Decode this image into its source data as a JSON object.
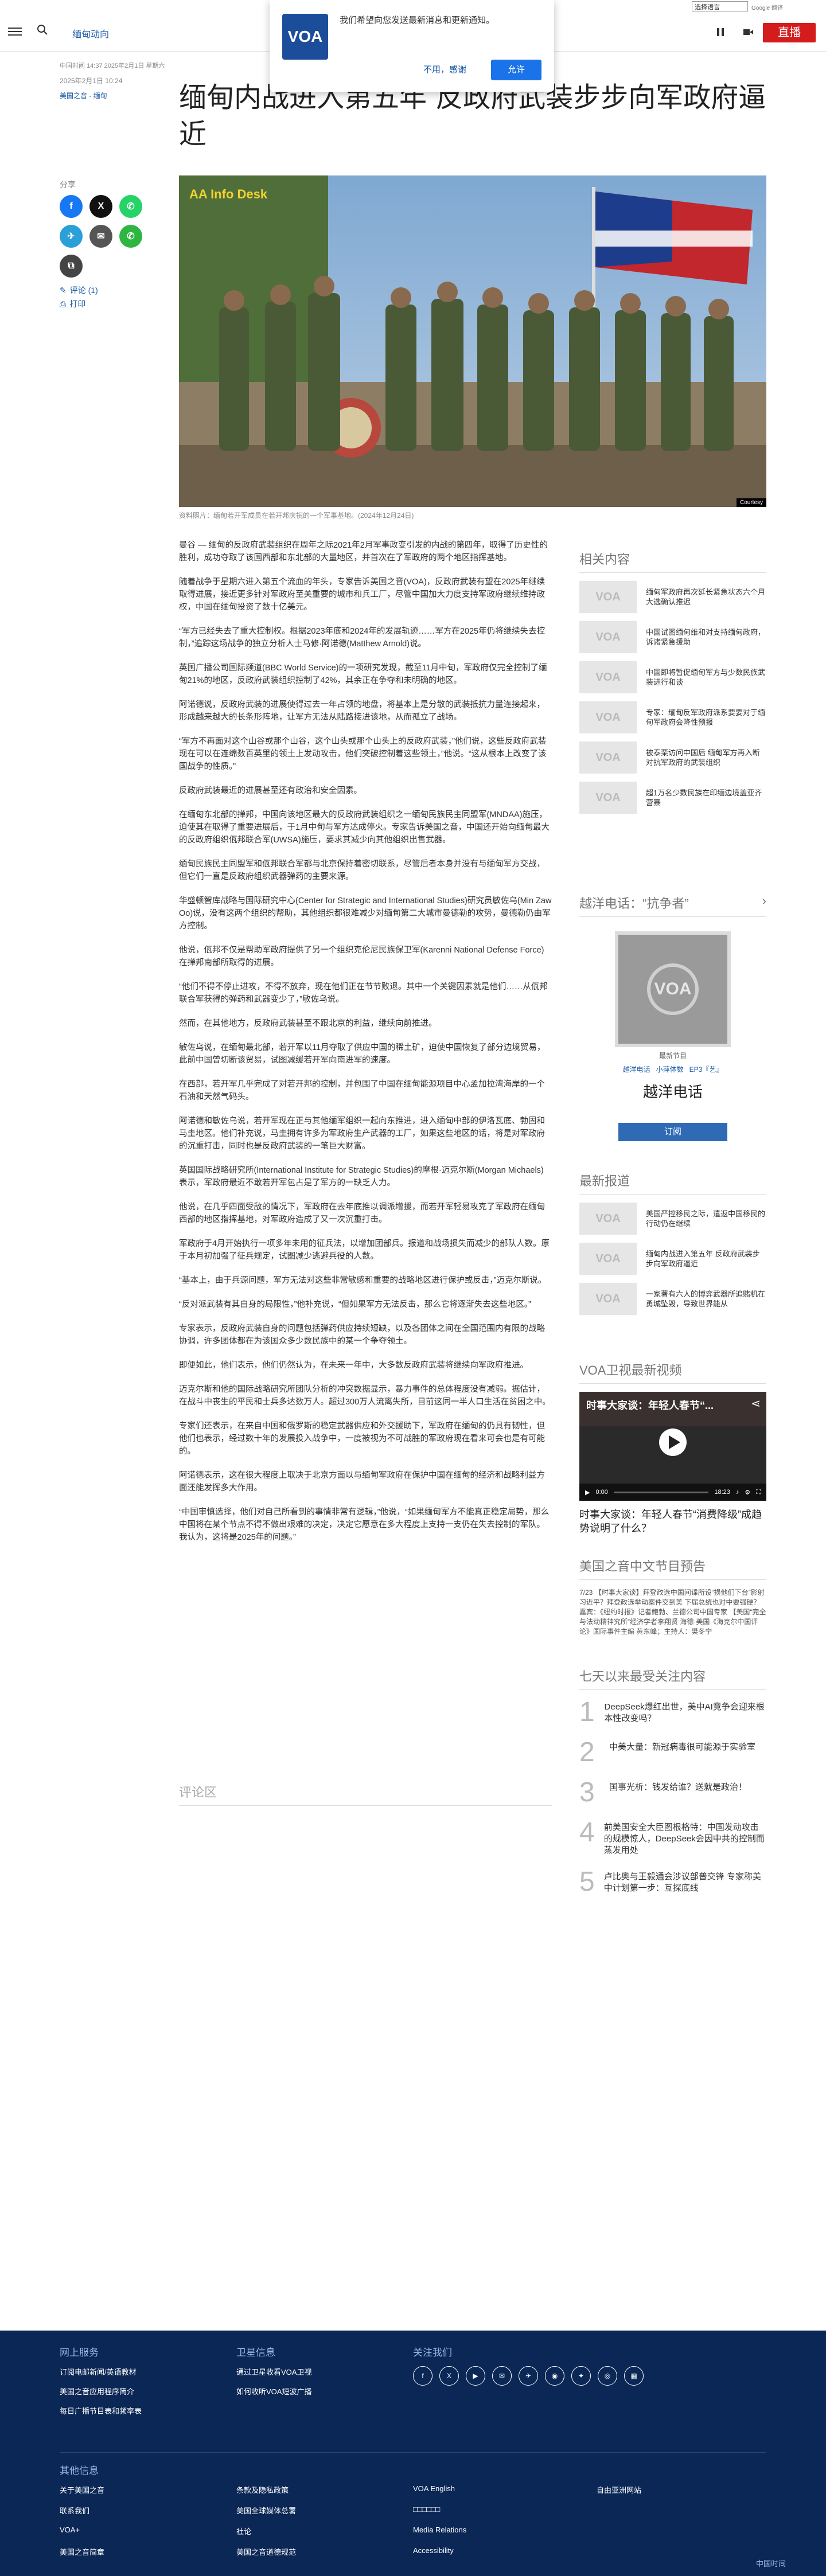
{
  "top": {
    "language_select": "选择语言",
    "translate_badge": "Google 翻译"
  },
  "header": {
    "section": "缅甸动向",
    "live": "直播"
  },
  "popup": {
    "logo": "VOA",
    "message": "我们希望向您发送最新消息和更新通知。",
    "deny": "不用，感谢",
    "allow": "允许"
  },
  "meta": {
    "date_line": "中国时间 14:37 2025年2月1日 星期六",
    "date2": "2025年2月1日 10:24",
    "author": "美国之音 - 缅甸"
  },
  "article": {
    "title": "缅甸内战进入第五年 反政府武装步步向军政府逼近",
    "image_label": "AA Info Desk",
    "image_credit": "Courtesy",
    "caption": "资料照片：缅甸若开军成员在若开邦庆祝的一个军事基地。(2024年12月24日)",
    "paragraphs": [
      "曼谷 — 缅甸的反政府武装组织在周年之际2021年2月军事政变引发的内战的第四年，取得了历史性的胜利，成功夺取了该国西部和东北部的大量地区，并首次在了军政府的两个地区指挥基地。",
      "随着战争于星期六进入第五个流血的年头，专家告诉美国之音(VOA)，反政府武装有望在2025年继续取得进展，接近更多针对军政府至关重要的城市和兵工厂，尽管中国加大力度支持军政府继续维持政权，中国在缅甸投资了数十亿美元。",
      "“军方已经失去了重大控制权。根据2023年底和2024年的发展轨迹……军方在2025年仍将继续失去控制，”追踪这场战争的独立分析人士马修·阿诺德(Matthew Arnold)说。",
      "英国广播公司国际频道(BBC World Service)的一项研究发现，截至11月中旬，军政府仅完全控制了缅甸21%的地区，反政府武装组织控制了42%，其余正在争夺和未明确的地区。",
      "阿诺德说，反政府武装的进展使得过去一年占领的地盘，将基本上是分散的武装抵抗力量连接起来，形成越来越大的长条形阵地，让军方无法从陆路接进该地，从而孤立了战场。",
      "“军方不再面对这个山谷或那个山谷，这个山头或那个山头上的反政府武装，”他们说，这些反政府武装现在可以在连绵数百英里的领土上发动攻击，他们突破控制着这些领土，”他说。“这从根本上改变了该国战争的性质。”",
      "反政府武装最近的进展甚至还有政治和安全因素。",
      "在缅甸东北部的掸邦，中国向该地区最大的反政府武装组织之一缅甸民族民主同盟军(MNDAA)施压，迫使其在取得了重要进展后，于1月中旬与军方达成停火。专家告诉美国之音，中国还开始向缅甸最大的反政府组织佤邦联合军(UWSA)施压，要求其减少向其他组织出售武器。",
      "缅甸民族民主同盟军和佤邦联合军都与北京保持着密切联系，尽管后者本身并没有与缅甸军方交战，但它们一直是反政府组织武器弹药的主要来源。",
      "华盛顿智库战略与国际研究中心(Center for Strategic and International Studies)研究员敏佐乌(Min Zaw Oo)说，没有这两个组织的帮助，其他组织都很难减少对缅甸第二大城市曼德勒的攻势，曼德勒仍由军方控制。",
      "他说，佤邦不仅是帮助军政府提供了另一个组织克伦尼民族保卫军(Karenni National Defense Force)在掸邦南部所取得的进展。",
      "“他们不得不停止进攻，不得不放弃，现在他们正在节节败退。其中一个关键因素就是他们……从佤邦联合军获得的弹药和武器变少了，”敏佐乌说。",
      "然而，在其他地方，反政府武装甚至不跟北京的利益，继续向前推进。",
      "敏佐乌说，在缅甸最北部，若开军以11月夺取了供应中国的稀土矿，迫使中国恢复了部分边境贸易，此前中国曾切断该贸易，试图减缓若开军向南进军的速度。",
      "在西部，若开军几乎完成了对若开邦的控制，并包围了中国在缅甸能源项目中心孟加拉湾海岸的一个石油和天然气码头。",
      "阿诺德和敏佐乌说，若开军现在正与其他缅军组织一起向东推进，进入缅甸中部的伊洛瓦底、勃固和马圭地区。他们补充说，马圭拥有许多为军政府生产武器的工厂，如果这些地区的话，将是对军政府的沉重打击，同时也是反政府武装的一笔巨大财富。",
      "英国国际战略研究所(International Institute for Strategic Studies)的摩根·迈克尔斯(Morgan Michaels)表示，军政府最近不敢若开军包占是了军方的一缺乏人力。",
      "他说，在几乎四面受敌的情况下，军政府在去年底推以调派增援，而若开军轻易攻克了军政府在缅甸西部的地区指挥基地，对军政府造成了又一次沉重打击。",
      "军政府于4月开始执行一项多年未用的征兵法，以增加团部兵。报道和战场损失而减少的部队人数。原于本月初加强了征兵规定，试图减少逃避兵役的人数。",
      "“基本上，由于兵源问题，军方无法对这些非常敏感和重要的战略地区进行保护或反击，”迈克尔斯说。",
      "“反对派武装有其自身的局限性，”他补充说，“但如果军方无法反击，那么它将逐渐失去这些地区。”",
      "专家表示，反政府武装自身的问题包括弹药供应持续短缺，以及各团体之间在全国范围内有限的战略协调，许多团体都在为该国众多少数民族中的某一个争夺领土。",
      "即便如此，他们表示，他们仍然认为，在未来一年中，大多数反政府武装将继续向军政府推进。",
      "迈克尔斯和他的国际战略研究所团队分析的冲突数据显示，暴力事件的总体程度没有减弱。据估计，在战斗中丧生的平民和士兵多达数万人。超过300万人流离失所，目前这同一半人口生活在贫困之中。",
      "专家们还表示，在来自中国和俄罗斯的稳定武器供应和外交援助下，军政府在缅甸的仍具有韧性，但他们也表示，经过数十年的发展投入战争中，一度被视为不可战胜的军政府现在看来可会也是有可能的。",
      "阿诺德表示，这在很大程度上取决于北京方面以与缅甸军政府在保护中国在缅甸的经济和战略利益方面还能发挥多大作用。",
      "“中国审慎选择，他们对自己所看到的事情非常有逻辑，”他说，“如果缅甸军方不能真正稳定局势，那么中国将在某个节点不得不做出艰难的决定，决定它愿意在多大程度上支持一支仍在失去控制的军队。我认为，这将是2025年的问题。”"
    ],
    "comments": "评论区"
  },
  "share": {
    "title": "分享",
    "comments_link": "评论 (1)",
    "print_link": "打印"
  },
  "sidebar": {
    "related_title": "相关内容",
    "related": [
      "缅甸军政府再次延长紧急状态六个月 大选确认推迟",
      "中国试图缅甸维和对支持缅甸政府，诉诸紧急援助",
      "中国即将暂促缅甸军方与少数民族武装进行和谈",
      "专家：缅甸反军政府派系要要对于缅甸军政府会降性预报",
      "被泰栗访问中国后 缅甸军方再入断对抗军政府的武装组织",
      "超1万名少数民族在印缅边境盖亚齐营寨"
    ],
    "podcast_title": "越洋电话：“抗争者”",
    "podcast_label": "最新节目",
    "podcast_links": [
      "越洋电话",
      "小萍体数",
      "EP3『艺』"
    ],
    "podcast_name": "越洋电话",
    "subscribe": "订阅",
    "latest_title": "最新报道",
    "latest": [
      "美国严控移民之际，遣返中国移民的行动仍在继续",
      "缅甸内战进入第五年 反政府武装步步向军政府逼近",
      "一家著有六人的博弈武器所追赌机在勇城坠毁，导致世界能从"
    ],
    "video_title": "VOA卫视最新视频",
    "video_overlay": "时事大家谈：年轻人春节“...",
    "video_time_current": "0:00",
    "video_time_total": "18:23",
    "video_caption": "时事大家谈：年轻人春节“消费降级”成趋势说明了什么？",
    "schedule_title": "美国之音中文节目预告",
    "schedule_text": "7/23 【时事大家谈】拜登政选中国间谍所设“损他们下台”影射习近平？拜登政选举动案件交到美 下届总统也对中要强硬？嘉宾：《纽约时报》记者鲍勃、兰德公司中国专家 【美国“完全与法动精神究所”经济学者李翔贤 海德·美国《海克尔中国评论》国际事件主编 黄东峰；主持人：樊冬宁",
    "top_title": "七天以来最受关注内容",
    "top": [
      "DeepSeek爆红出世，美中AI竞争会迎来根本性改变吗？",
      "中美大量：新冠病毒很可能源于实验室",
      "国事光析：钱发给谁？送就是政治！",
      "前美国安全大臣图根格特：中国发动攻击的规模惊人，DeepSeek会因中共的控制而蒸发用处",
      "卢比奥与王毅通会涉议部普交锋 专家称美中计划第一步：互探底线"
    ]
  },
  "footer": {
    "col1_title": "网上服务",
    "col1": [
      "订阅电邮新闻/英语教材",
      "美国之音应用程序简介",
      "每日广播节目表和频率表"
    ],
    "col2_title": "卫星信息",
    "col2": [
      "通过卫星收看VOA卫视",
      "如何收听VOA短波广播"
    ],
    "col3_title": "关注我们",
    "social_icons": [
      "f",
      "X",
      "▶",
      "✉",
      "✈",
      "◉",
      "✦",
      "◎",
      "▦"
    ],
    "other_title": "其他信息",
    "other": [
      [
        "关于美国之音",
        "条款及隐私政策",
        "VOA English",
        "自由亚洲网站"
      ],
      [
        "联系我们",
        "美国全球媒体总署",
        "□□□□□□",
        ""
      ],
      [
        "VOA+",
        "社论",
        "Media Relations",
        ""
      ],
      [
        "美国之音简章",
        "美国之音道德规范",
        "Accessibility",
        ""
      ]
    ],
    "corner": "中国时间"
  }
}
